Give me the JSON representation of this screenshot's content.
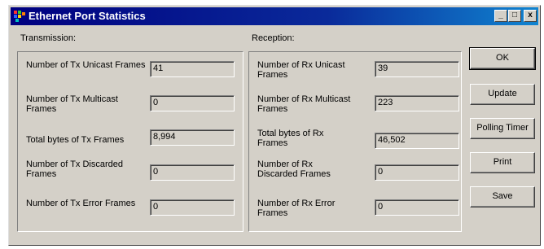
{
  "window": {
    "title": "Ethernet Port Statistics",
    "controls": {
      "minimize": "_",
      "maximize": "□",
      "close": "x"
    }
  },
  "transmission": {
    "title": "Transmission:",
    "rows": [
      {
        "label": "Number of Tx Unicast Frames",
        "value": "41"
      },
      {
        "label": "Number of Tx Multicast Frames",
        "value": "0"
      },
      {
        "label": "Total bytes of Tx Frames",
        "value": "8,994"
      },
      {
        "label": "Number of Tx Discarded Frames",
        "value": "0"
      },
      {
        "label": "Number of Tx Error Frames",
        "value": "0"
      }
    ]
  },
  "reception": {
    "title": "Reception:",
    "rows": [
      {
        "label": "Number of Rx Unicast Frames",
        "value": "39"
      },
      {
        "label": "Number of Rx Multicast Frames",
        "value": "223"
      },
      {
        "label": "Total bytes of Rx Frames",
        "value": "46,502"
      },
      {
        "label": "Number of Rx Discarded Frames",
        "value": "0"
      },
      {
        "label": "Number of Rx Error Frames",
        "value": "0"
      }
    ]
  },
  "buttons": {
    "ok": "OK",
    "update": "Update",
    "polling_timer": "Polling Timer",
    "print": "Print",
    "save": "Save"
  },
  "colors": {
    "dialog_face": "#d4d0c8",
    "title_gradient_start": "#000080",
    "title_gradient_end": "#1084d0"
  },
  "icons": {
    "app": "app-icon",
    "minimize": "minimize-icon",
    "maximize": "maximize-icon",
    "close": "close-icon"
  }
}
